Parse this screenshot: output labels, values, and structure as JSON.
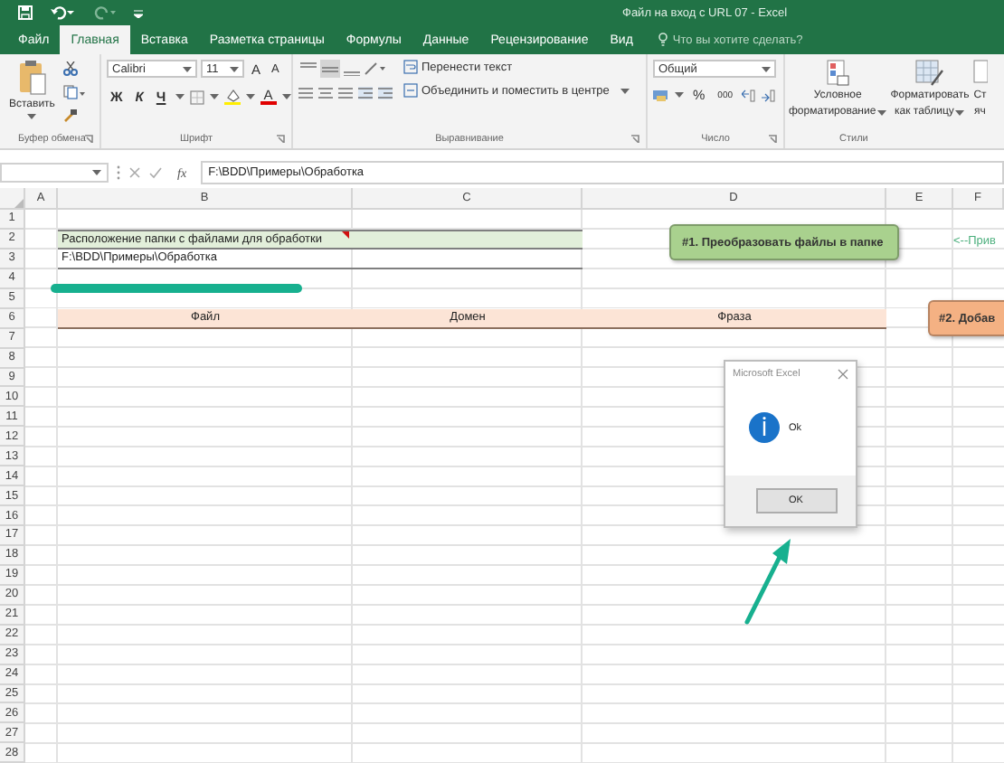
{
  "title_bar": {
    "title": "Файл на вход с URL 07 - Excel"
  },
  "tabs": [
    {
      "label": "Файл",
      "selected": false
    },
    {
      "label": "Главная",
      "selected": true
    },
    {
      "label": "Вставка",
      "selected": false
    },
    {
      "label": "Разметка страницы",
      "selected": false
    },
    {
      "label": "Формулы",
      "selected": false
    },
    {
      "label": "Данные",
      "selected": false
    },
    {
      "label": "Рецензирование",
      "selected": false
    },
    {
      "label": "Вид",
      "selected": false
    }
  ],
  "tell_me": {
    "placeholder": "Что вы хотите сделать?"
  },
  "clipboard": {
    "paste_label": "Вставить",
    "group_label": "Буфер обмена"
  },
  "font": {
    "family": "Calibri",
    "size": "11",
    "grow": "A",
    "shrink": "A",
    "bold": "Ж",
    "italic": "К",
    "underline": "Ч",
    "color_letter": "A",
    "group_label": "Шрифт"
  },
  "alignment": {
    "valign": [
      {
        "selected": false
      },
      {
        "selected": true
      },
      {
        "selected": false
      }
    ],
    "wrap_label": "Перенести текст",
    "merge_label": "Объединить и поместить в центре",
    "group_label": "Выравнивание"
  },
  "number": {
    "format": "Общий",
    "percent": "%",
    "thousands": "000",
    "group_label": "Число"
  },
  "styles": {
    "buttons": [
      {
        "kind": "conditional",
        "lines": [
          "Условное",
          "форматирование"
        ]
      },
      {
        "kind": "table",
        "lines": [
          "Форматировать",
          "как таблицу"
        ]
      },
      {
        "kind": "cell",
        "lines": [
          "Ст",
          "яч"
        ]
      }
    ],
    "group_label": "Стили"
  },
  "formula_bar": {
    "fx": "fx",
    "value": "F:\\BDD\\Примеры\\Обработка"
  },
  "sheet": {
    "columns": [
      "A",
      "B",
      "C",
      "D",
      "E",
      "F"
    ],
    "rows": [
      {
        "number": "1"
      },
      {
        "number": "2",
        "kind": "label",
        "cells": [
          "Расположение папки с файлами для обработки"
        ]
      },
      {
        "number": "3",
        "kind": "value",
        "cells": [
          "F:\\BDD\\Примеры\\Обработка"
        ]
      },
      {
        "number": "4"
      },
      {
        "number": "5"
      },
      {
        "number": "6",
        "kind": "header",
        "cells": [
          "Файл",
          "Домен",
          "Фраза"
        ]
      },
      {
        "number": "7"
      },
      {
        "number": "8"
      },
      {
        "number": "9"
      },
      {
        "number": "10"
      },
      {
        "number": "11"
      },
      {
        "number": "12"
      },
      {
        "number": "13"
      },
      {
        "number": "14"
      },
      {
        "number": "15"
      },
      {
        "number": "16"
      },
      {
        "number": "17"
      },
      {
        "number": "18"
      },
      {
        "number": "19"
      },
      {
        "number": "20"
      },
      {
        "number": "21"
      },
      {
        "number": "22"
      },
      {
        "number": "23"
      },
      {
        "number": "24"
      },
      {
        "number": "25"
      },
      {
        "number": "26"
      },
      {
        "number": "27"
      },
      {
        "number": "28"
      }
    ]
  },
  "shapes": [
    {
      "text": "#1. Преобразовать файлы в папке",
      "color": "#a9d18e"
    },
    {
      "text": "#2. Добав",
      "color": "#f4b183"
    }
  ],
  "note": {
    "text": "<--Прив"
  },
  "dialog": {
    "title": "Microsoft Excel",
    "message": "Ok",
    "button": "OK"
  }
}
